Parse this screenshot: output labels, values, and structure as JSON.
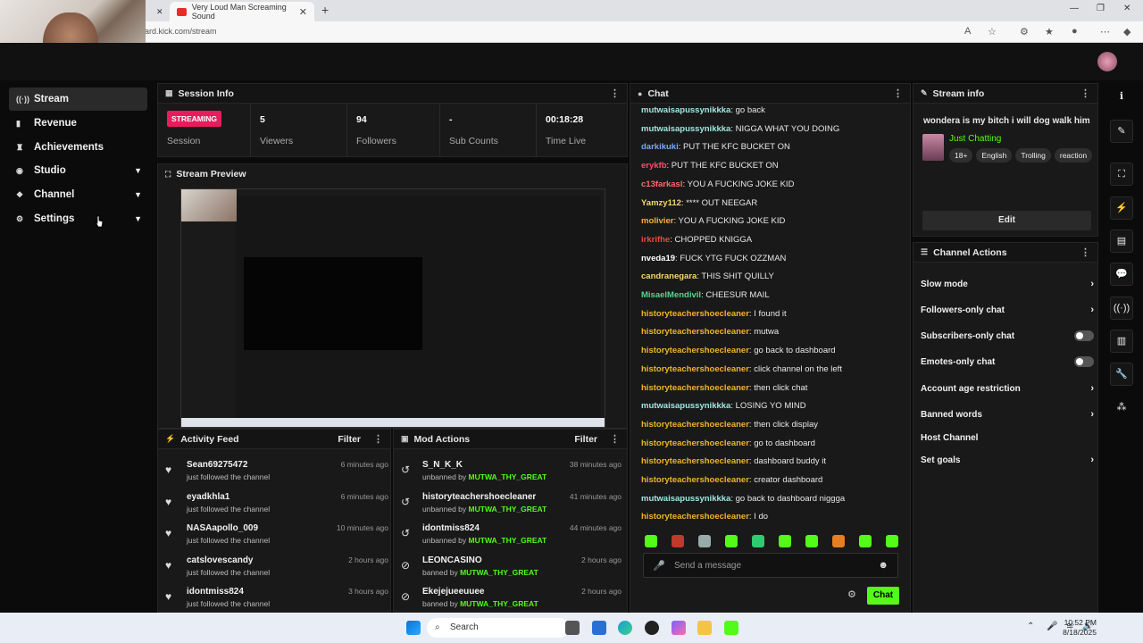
{
  "browser": {
    "tab_title": "Very Loud Man Screaming Sound",
    "url": "ard.kick.com/stream"
  },
  "sidebar": {
    "items": [
      {
        "label": "Stream",
        "icon": "broadcast-icon",
        "active": true,
        "expandable": false
      },
      {
        "label": "Revenue",
        "icon": "revenue-icon",
        "active": false,
        "expandable": false
      },
      {
        "label": "Achievements",
        "icon": "trophy-icon",
        "active": false,
        "expandable": false
      },
      {
        "label": "Studio",
        "icon": "studio-icon",
        "active": false,
        "expandable": true
      },
      {
        "label": "Channel",
        "icon": "channel-icon",
        "active": false,
        "expandable": true
      },
      {
        "label": "Settings",
        "icon": "gear-icon",
        "active": false,
        "expandable": true
      }
    ]
  },
  "session": {
    "title": "Session Info",
    "status": "STREAMING",
    "status_label": "Session",
    "stats": [
      {
        "value": "5",
        "label": "Viewers"
      },
      {
        "value": "94",
        "label": "Followers"
      },
      {
        "value": "-",
        "label": "Sub Counts"
      },
      {
        "value": "00:18:28",
        "label": "Time Live"
      }
    ]
  },
  "preview": {
    "title": "Stream Preview"
  },
  "activity": {
    "title": "Activity Feed",
    "filter": "Filter",
    "items": [
      {
        "name": "Sean69275472",
        "text": "just followed the channel",
        "time": "6 minutes ago"
      },
      {
        "name": "eyadkhla1",
        "text": "just followed the channel",
        "time": "6 minutes ago"
      },
      {
        "name": "NASAapollo_009",
        "text": "just followed the channel",
        "time": "10 minutes ago"
      },
      {
        "name": "catslovescandy",
        "text": "just followed the channel",
        "time": "2 hours ago"
      },
      {
        "name": "idontmiss824",
        "text": "just followed the channel",
        "time": "3 hours ago"
      }
    ]
  },
  "mod": {
    "title": "Mod Actions",
    "filter": "Filter",
    "items": [
      {
        "name": "S_N_K_K",
        "action": "unbanned by",
        "by": "MUTWA_THY_GREAT",
        "time": "38 minutes ago"
      },
      {
        "name": "historyteachershoecleaner",
        "action": "unbanned by",
        "by": "MUTWA_THY_GREAT",
        "time": "41 minutes ago"
      },
      {
        "name": "idontmiss824",
        "action": "unbanned by",
        "by": "MUTWA_THY_GREAT",
        "time": "44 minutes ago"
      },
      {
        "name": "LEONCASINO",
        "action": "banned by",
        "by": "MUTWA_THY_GREAT",
        "time": "2 hours ago"
      },
      {
        "name": "Ekejejueeuuee",
        "action": "banned by",
        "by": "MUTWA_THY_GREAT",
        "time": "2 hours ago"
      }
    ]
  },
  "chat": {
    "title": "Chat",
    "placeholder": "Send a message",
    "send_label": "Chat",
    "messages": [
      {
        "user": "mutwaisapussynikkka",
        "color": "#9ee7e0",
        "text": "go back"
      },
      {
        "user": "mutwaisapussynikkka",
        "color": "#9ee7e0",
        "text": "NIGGA WHAT YOU DOING"
      },
      {
        "user": "darkikuki",
        "color": "#7aa6ff",
        "text": "PUT THE KFC BUCKET ON"
      },
      {
        "user": "erykfb",
        "color": "#ff4d6d",
        "text": "PUT THE KFC BUCKET ON"
      },
      {
        "user": "c13farkasl",
        "color": "#ff6b6b",
        "text": "YOU A FUCKING JOKE KID"
      },
      {
        "user": "Yamzy112",
        "color": "#f5d76e",
        "text": "**** OUT NEEGAR"
      },
      {
        "user": "molivier",
        "color": "#f5b041",
        "text": "YOU A FUCKING JOKE KID"
      },
      {
        "user": "irkrifhe",
        "color": "#e74c3c",
        "text": "CHOPPED KNIGGA"
      },
      {
        "user": "nveda19",
        "color": "#ffffff",
        "text": "FUCK YTG FUCK OZZMAN"
      },
      {
        "user": "candranegara",
        "color": "#f5d76e",
        "text": "THIS SHIT QUILLY"
      },
      {
        "user": "MisaelMendivil",
        "color": "#58d68d",
        "text": "CHEESUR MAIL"
      },
      {
        "user": "historyteachershoecleaner",
        "color": "#f0b429",
        "text": "I found it"
      },
      {
        "user": "historyteachershoecleaner",
        "color": "#f0b429",
        "text": "mutwa"
      },
      {
        "user": "historyteachershoecleaner",
        "color": "#f0b429",
        "text": "go back to dashboard"
      },
      {
        "user": "historyteachershoecleaner",
        "color": "#f0b429",
        "text": "click channel on the left"
      },
      {
        "user": "historyteachershoecleaner",
        "color": "#f0b429",
        "text": "then click chat"
      },
      {
        "user": "mutwaisapussynikkka",
        "color": "#9ee7e0",
        "text": "LOSING YO MIND"
      },
      {
        "user": "historyteachershoecleaner",
        "color": "#f0b429",
        "text": "then click display"
      },
      {
        "user": "historyteachershoecleaner",
        "color": "#f0b429",
        "text": "go to dashboard"
      },
      {
        "user": "historyteachershoecleaner",
        "color": "#f0b429",
        "text": "dashboard buddy it"
      },
      {
        "user": "historyteachershoecleaner",
        "color": "#f0b429",
        "text": "creator dashboard"
      },
      {
        "user": "mutwaisapussynikkka",
        "color": "#9ee7e0",
        "text": "go back to dashboard niggga"
      },
      {
        "user": "historyteachershoecleaner",
        "color": "#f0b429",
        "text": "I do"
      }
    ]
  },
  "stream_info": {
    "title": "Stream info",
    "stream_title": "wondera is my bitch i will dog walk him",
    "category": "Just Chatting",
    "tags": [
      "18+",
      "English",
      "Trolling",
      "reaction"
    ],
    "edit_label": "Edit"
  },
  "channel_actions": {
    "title": "Channel Actions",
    "items": [
      {
        "label": "Slow mode",
        "control": "chevron"
      },
      {
        "label": "Followers-only chat",
        "control": "chevron"
      },
      {
        "label": "Subscribers-only chat",
        "control": "toggle"
      },
      {
        "label": "Emotes-only chat",
        "control": "toggle"
      },
      {
        "label": "Account age restriction",
        "control": "chevron"
      },
      {
        "label": "Banned words",
        "control": "chevron"
      },
      {
        "label": "Host Channel",
        "control": "none"
      },
      {
        "label": "Set goals",
        "control": "chevron"
      }
    ]
  },
  "taskbar": {
    "search_label": "Search",
    "time": "10:52 PM",
    "date": "8/18/2025"
  },
  "colors": {
    "accent": "#53fc18",
    "live_badge": "#e61d5d",
    "panel": "#191919"
  }
}
